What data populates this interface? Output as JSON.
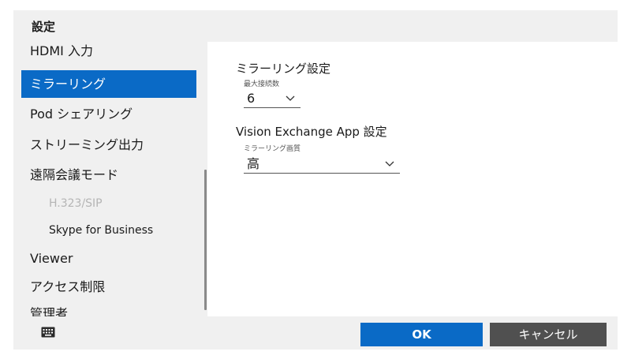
{
  "window": {
    "title": "設定"
  },
  "sidebar": {
    "items": [
      {
        "label": "HDMI 入力",
        "state": "normal"
      },
      {
        "label": "ミラーリング",
        "state": "selected"
      },
      {
        "label": "Pod シェアリング",
        "state": "normal"
      },
      {
        "label": "ストリーミング出力",
        "state": "normal"
      },
      {
        "label": "遠隔会議モード",
        "state": "normal"
      },
      {
        "label": "H.323/SIP",
        "state": "disabled"
      },
      {
        "label": "Skype for Business",
        "state": "normal"
      },
      {
        "label": "Viewer",
        "state": "normal"
      },
      {
        "label": "アクセス制限",
        "state": "normal"
      },
      {
        "label": "管理者",
        "state": "normal"
      }
    ]
  },
  "content": {
    "mirroring": {
      "title": "ミラーリング設定",
      "max_connections_label": "最大接続数",
      "max_connections_value": "6"
    },
    "vision_exchange": {
      "title": "Vision Exchange App 設定",
      "quality_label": "ミラーリング画質",
      "quality_value": "高"
    }
  },
  "footer": {
    "keyboard_icon": "keyboard-icon",
    "ok_label": "OK",
    "cancel_label": "キャンセル"
  },
  "colors": {
    "accent": "#0a6ac6",
    "cancel_button": "#505050",
    "panel_background": "#f0f0f0",
    "disabled_text": "#b5b5b5"
  }
}
